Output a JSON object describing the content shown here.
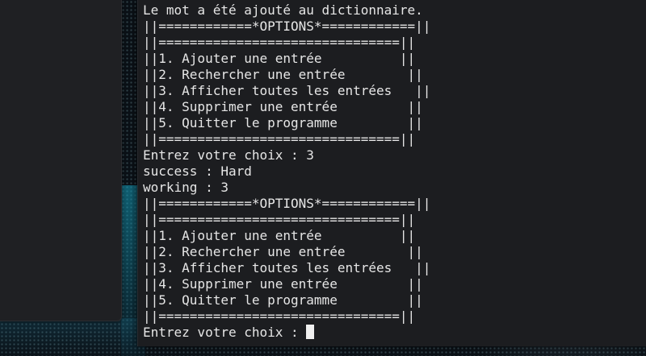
{
  "terminal": {
    "lines": [
      "Le mot a été ajouté au dictionnaire.",
      "||============*OPTIONS*============||",
      "||===============================||",
      "||1. Ajouter une entrée          ||",
      "||2. Rechercher une entrée        ||",
      "||3. Afficher toutes les entrées   ||",
      "||4. Supprimer une entrée         ||",
      "||5. Quitter le programme         ||",
      "||===============================||",
      "Entrez votre choix : 3",
      "success : Hard",
      "working : 3",
      "||============*OPTIONS*============||",
      "||===============================||",
      "||1. Ajouter une entrée          ||",
      "||2. Rechercher une entrée        ||",
      "||3. Afficher toutes les entrées   ||",
      "||4. Supprimer une entrée         ||",
      "||5. Quitter le programme         ||",
      "||===============================||"
    ],
    "prompt": "Entrez votre choix : "
  },
  "colors": {
    "terminal_bg": "#1c1d20",
    "text": "#e6e6e6",
    "wallpaper_accent": "#14a0be"
  }
}
